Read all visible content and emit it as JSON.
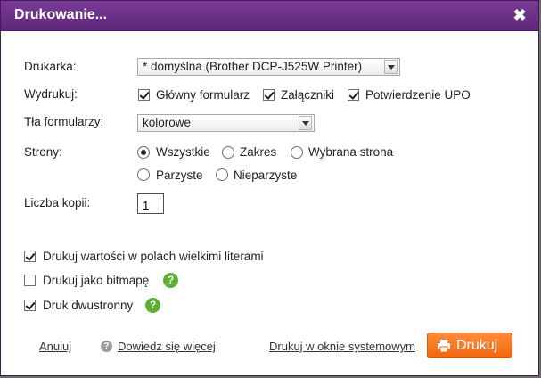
{
  "dialog": {
    "title": "Drukowanie...",
    "close_symbol": "✖"
  },
  "printer": {
    "label": "Drukarka:",
    "selected": "* domyślna (Brother DCP-J525W Printer)"
  },
  "print_items": {
    "label": "Wydrukuj:",
    "options": [
      {
        "label": "Główny formularz",
        "checked": true
      },
      {
        "label": "Załączniki",
        "checked": true
      },
      {
        "label": "Potwierdzenie UPO",
        "checked": true
      }
    ]
  },
  "background": {
    "label": "Tła formularzy:",
    "selected": "kolorowe"
  },
  "pages": {
    "label": "Strony:",
    "options": [
      {
        "label": "Wszystkie",
        "selected": true
      },
      {
        "label": "Zakres",
        "selected": false
      },
      {
        "label": "Wybrana strona",
        "selected": false
      },
      {
        "label": "Parzyste",
        "selected": false
      },
      {
        "label": "Nieparzyste",
        "selected": false
      }
    ]
  },
  "copies": {
    "label": "Liczba kopii:",
    "value": "1"
  },
  "options": [
    {
      "label": "Drukuj wartości w polach wielkimi literami",
      "checked": true,
      "help": false
    },
    {
      "label": "Drukuj jako bitmapę",
      "checked": false,
      "help": true
    },
    {
      "label": "Druk dwustronny",
      "checked": true,
      "help": true
    }
  ],
  "footer": {
    "cancel": "Anuluj",
    "learn_more": "Dowiedz się więcej",
    "system_print": "Drukuj w oknie systemowym",
    "print": "Drukuj"
  },
  "colors": {
    "titlebar": "#6b3189",
    "print_button": "#f47a24",
    "help_badge": "#5fae34"
  }
}
